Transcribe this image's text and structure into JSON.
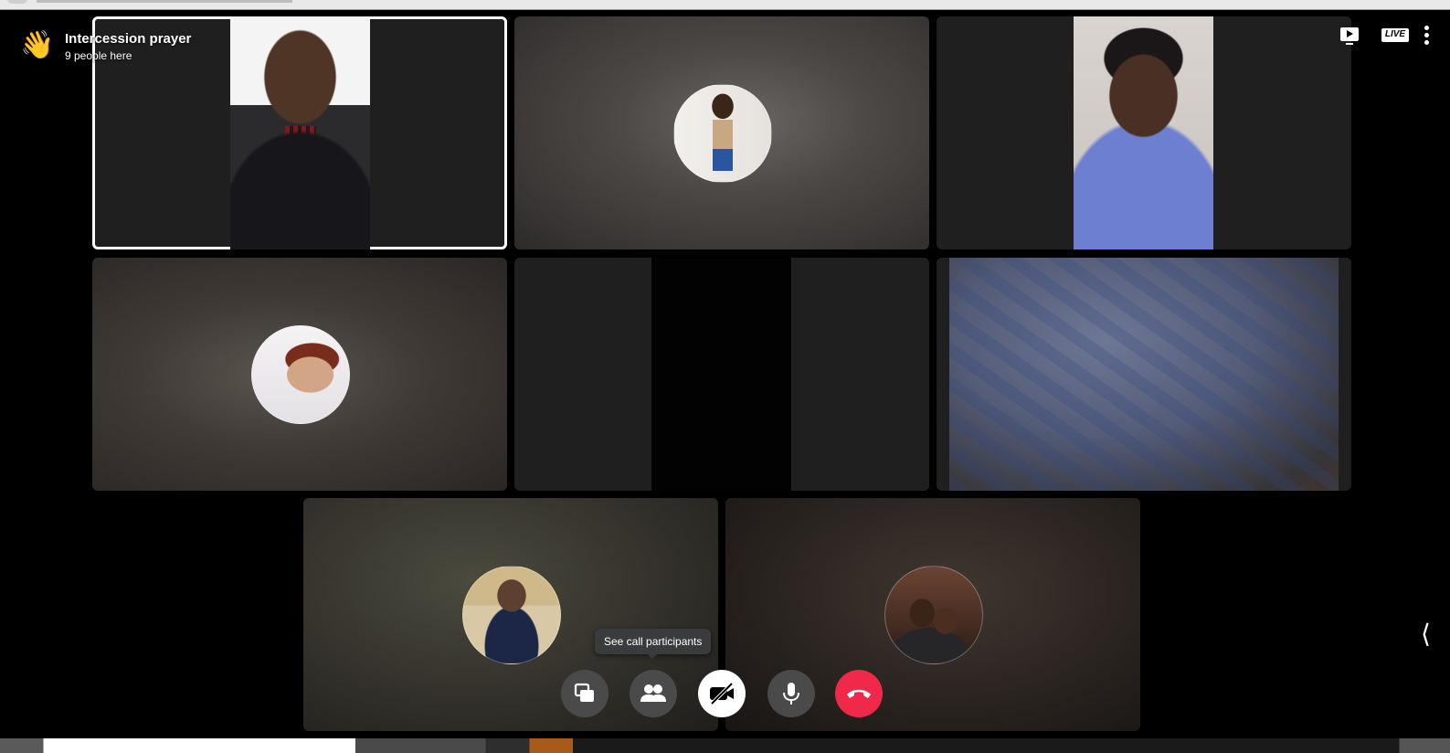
{
  "call": {
    "title": "Intercession prayer",
    "subtitle": "9 people here"
  },
  "topbar": {
    "live_label": "LIVE",
    "icons": [
      "screen-play-icon",
      "live-badge",
      "more-vertical-icon"
    ]
  },
  "participants": [
    {
      "name": "",
      "kind": "video",
      "icon": "video-man-icon"
    },
    {
      "name": "",
      "kind": "avatar",
      "icon": "avatar"
    },
    {
      "name": "",
      "kind": "video",
      "icon": "video-woman-icon"
    },
    {
      "name": "",
      "kind": "avatar",
      "icon": "avatar"
    },
    {
      "name": "",
      "kind": "video",
      "icon": "video-dark-icon"
    },
    {
      "name": "",
      "kind": "video",
      "icon": "video-blanket-icon"
    },
    {
      "name": "",
      "kind": "avatar",
      "icon": "avatar"
    },
    {
      "name": "",
      "kind": "avatar",
      "icon": "avatar"
    }
  ],
  "controls": {
    "tooltip": "See call participants",
    "buttons": [
      {
        "icon": "share-screen-icon"
      },
      {
        "icon": "participants-icon"
      },
      {
        "icon": "camera-off-icon"
      },
      {
        "icon": "microphone-icon"
      },
      {
        "icon": "end-call-icon"
      }
    ]
  },
  "colors": {
    "end_call": "#f02849",
    "control_bg": "#4a4a4a",
    "active_border": "#ffffff"
  }
}
